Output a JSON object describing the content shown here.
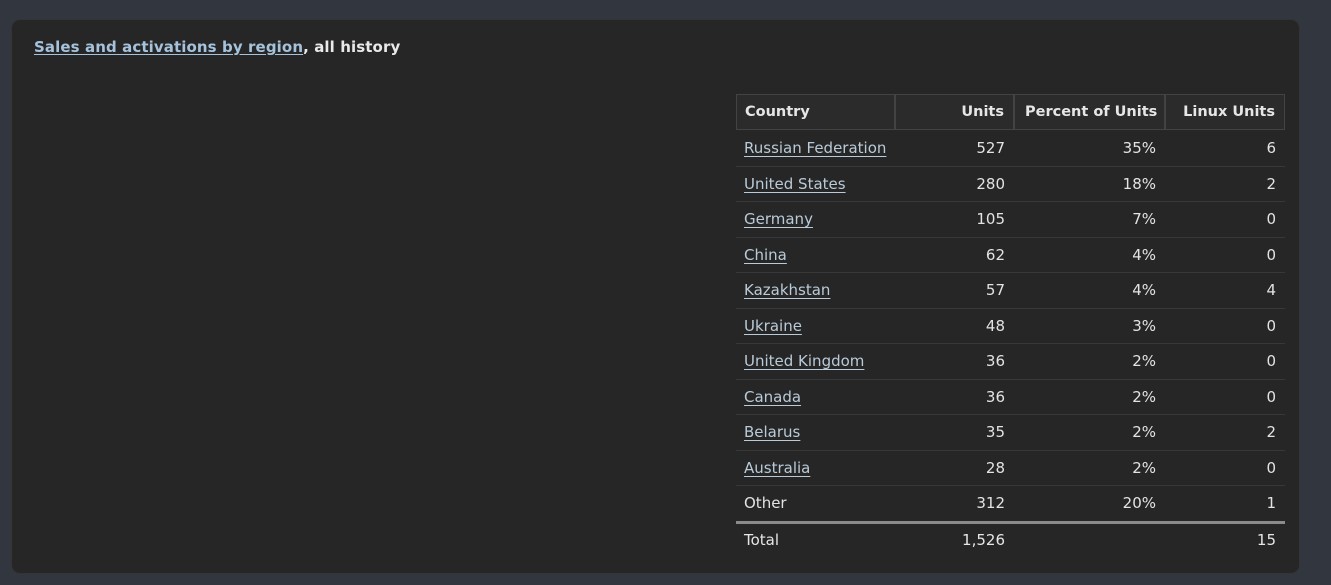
{
  "panel": {
    "title_link": "Sales and activations by region",
    "title_rest": ", all history"
  },
  "table": {
    "columns": [
      "Country",
      "Units",
      "Percent of Units",
      "Linux Units"
    ],
    "rows": [
      {
        "country": "Russian Federation",
        "link": true,
        "units": "527",
        "percent": "35%",
        "linux": "6"
      },
      {
        "country": "United States",
        "link": true,
        "units": "280",
        "percent": "18%",
        "linux": "2"
      },
      {
        "country": "Germany",
        "link": true,
        "units": "105",
        "percent": "7%",
        "linux": "0"
      },
      {
        "country": "China",
        "link": true,
        "units": "62",
        "percent": "4%",
        "linux": "0"
      },
      {
        "country": "Kazakhstan",
        "link": true,
        "units": "57",
        "percent": "4%",
        "linux": "4"
      },
      {
        "country": "Ukraine",
        "link": true,
        "units": "48",
        "percent": "3%",
        "linux": "0"
      },
      {
        "country": "United Kingdom",
        "link": true,
        "units": "36",
        "percent": "2%",
        "linux": "0"
      },
      {
        "country": "Canada",
        "link": true,
        "units": "36",
        "percent": "2%",
        "linux": "0"
      },
      {
        "country": "Belarus",
        "link": true,
        "units": "35",
        "percent": "2%",
        "linux": "2"
      },
      {
        "country": "Australia",
        "link": true,
        "units": "28",
        "percent": "2%",
        "linux": "0"
      },
      {
        "country": "Other",
        "link": false,
        "units": "312",
        "percent": "20%",
        "linux": "1"
      }
    ],
    "total": {
      "label": "Total",
      "units": "1,526",
      "percent": "",
      "linux": "15"
    }
  },
  "colors": {
    "page_background": "#32363e",
    "panel_background": "#262626",
    "link": "#b9cbd9",
    "title_link": "#a5c3dc",
    "text": "#e3e3e3",
    "row_divider": "#383838",
    "total_divider": "#8b8b8b",
    "header_border": "#434343"
  }
}
